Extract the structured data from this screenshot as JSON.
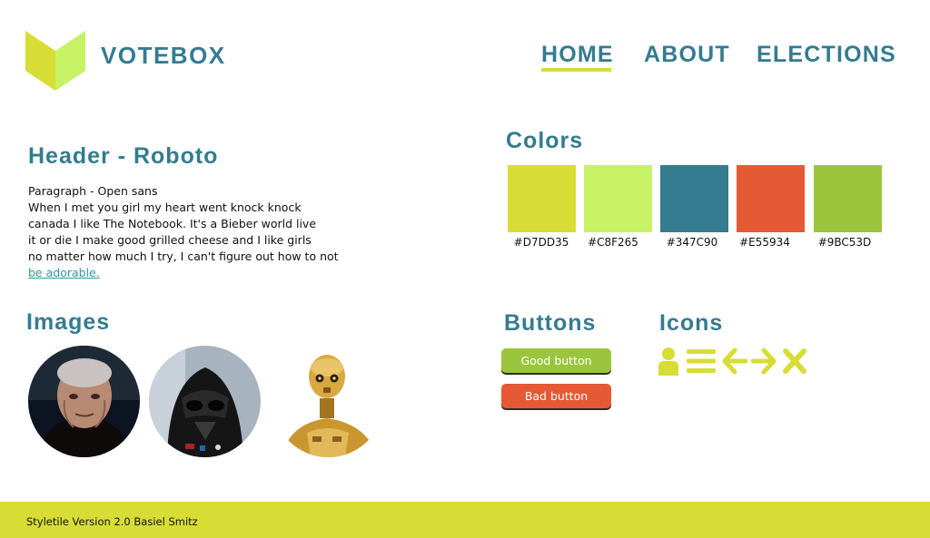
{
  "header": {
    "brand": "VOTEBOX",
    "nav": [
      "HOME",
      "ABOUT",
      "ELECTIONS"
    ],
    "active_nav": "HOME"
  },
  "typography": {
    "header_sample": "Header - Roboto",
    "paragraph_lines": [
      "Paragraph - Open sans",
      "When I met you girl my heart went knock knock",
      "canada I like The Notebook.  It's a Bieber world live",
      "it or die I make good grilled cheese and I like girls",
      "no matter how much I try, I can't figure out how to not"
    ],
    "link_text": "be adorable."
  },
  "colors": {
    "title": "Colors",
    "swatches": [
      {
        "hex": "#D7DD35",
        "label": "#D7DD35"
      },
      {
        "hex": "#C8F265",
        "label": "#C8F265"
      },
      {
        "hex": "#347C90",
        "label": "#347C90"
      },
      {
        "hex": "#E55934",
        "label": "#E55934"
      },
      {
        "hex": "#9BC53D",
        "label": "#9BC53D"
      }
    ]
  },
  "images": {
    "title": "Images",
    "items": [
      "palpatine-portrait",
      "darth-vader-portrait",
      "c3po-portrait"
    ]
  },
  "buttons": {
    "title": "Buttons",
    "good_label": "Good button",
    "bad_label": "Bad button"
  },
  "icons": {
    "title": "Icons",
    "items": [
      "user-icon",
      "menu-icon",
      "arrow-left-icon",
      "arrow-right-icon",
      "close-icon"
    ],
    "color": "#D7DD35"
  },
  "footer": {
    "text": "Styletile Version 2.0 Basiel Smitz"
  },
  "theme": {
    "accent": "#D7DD35",
    "primary_text": "#347C90"
  }
}
